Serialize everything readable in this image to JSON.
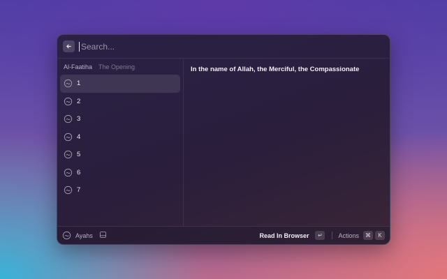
{
  "search": {
    "placeholder": "Search..."
  },
  "section": {
    "title": "Al-Faatiha",
    "subtitle": "The Opening"
  },
  "ayahs": [
    {
      "number": "1",
      "selected": true
    },
    {
      "number": "2",
      "selected": false
    },
    {
      "number": "3",
      "selected": false
    },
    {
      "number": "4",
      "selected": false
    },
    {
      "number": "5",
      "selected": false
    },
    {
      "number": "6",
      "selected": false
    },
    {
      "number": "7",
      "selected": false
    }
  ],
  "detail": {
    "text": "In the name of Allah, the Merciful, the Compassionate"
  },
  "footer": {
    "command_label": "Ayahs",
    "primary_action": "Read In Browser",
    "primary_shortcut": "↵",
    "actions_label": "Actions",
    "actions_shortcut": [
      "⌘",
      "K"
    ]
  },
  "icons": {
    "back": "arrow-left-icon",
    "ayah": "quran-icon",
    "extension": "extension-icon",
    "footer_badge": "book-icon"
  }
}
